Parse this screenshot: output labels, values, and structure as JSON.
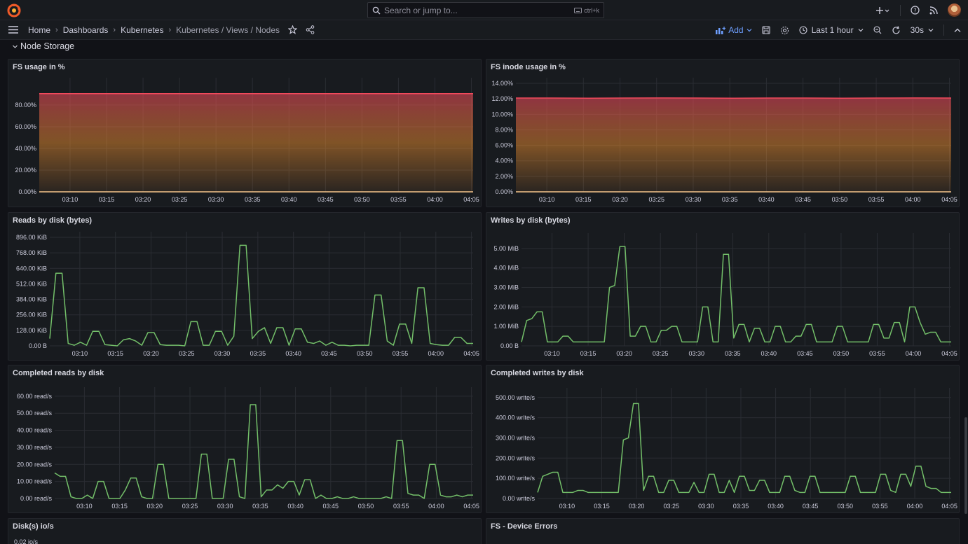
{
  "topbar": {
    "search_placeholder": "Search or jump to...",
    "search_shortcut": "ctrl+k",
    "icons": [
      "grafana-logo-icon",
      "search-icon",
      "keyboard-icon",
      "plus-icon",
      "help-icon",
      "rss-icon",
      "avatar"
    ]
  },
  "breadcrumbs": [
    "Home",
    "Dashboards",
    "Kubernetes",
    "Kubernetes / Views / Nodes"
  ],
  "toolbar": {
    "add_label": "Add",
    "time_range": "Last 1 hour",
    "refresh_interval": "30s"
  },
  "section": {
    "title": "Node Storage"
  },
  "colors": {
    "green": "#73bf69",
    "red": "#f2495c",
    "orange_fill": "#ff9830",
    "threshold": "#f5c48a"
  },
  "panels": [
    {
      "title": "FS usage in %",
      "chart_data": {
        "type": "area",
        "x_ticks": [
          "03:10",
          "03:15",
          "03:20",
          "03:25",
          "03:30",
          "03:35",
          "03:40",
          "03:45",
          "03:50",
          "03:55",
          "04:00",
          "04:05"
        ],
        "y_ticks": [
          "80.00%",
          "60.00%",
          "40.00%",
          "20.00%",
          "0.00%"
        ],
        "ylim": [
          0,
          100
        ],
        "series": [
          {
            "values": [
              90.5,
              90.5,
              90.5,
              90.5,
              90.5,
              90.5,
              90.5,
              90.5,
              90.5,
              90.5,
              90.5,
              90.5,
              90.5
            ]
          },
          {
            "values": [
              0,
              0,
              0,
              0,
              0,
              0,
              0,
              0,
              0,
              0,
              0,
              0,
              0
            ]
          }
        ]
      }
    },
    {
      "title": "FS inode usage in %",
      "chart_data": {
        "type": "area",
        "x_ticks": [
          "03:10",
          "03:15",
          "03:20",
          "03:25",
          "03:30",
          "03:35",
          "03:40",
          "03:45",
          "03:50",
          "03:55",
          "04:00",
          "04:05"
        ],
        "y_ticks": [
          "14.00%",
          "12.00%",
          "10.00%",
          "8.00%",
          "6.00%",
          "4.00%",
          "2.00%",
          "0.00%"
        ],
        "ylim": [
          0,
          14
        ],
        "series": [
          {
            "values": [
              12.1,
              12.1,
              12.08,
              12.1,
              12.12,
              12.1,
              12.08,
              12.1,
              12.1,
              12.08,
              12.1,
              12.12,
              12.1
            ]
          },
          {
            "values": [
              0,
              0,
              0,
              0,
              0,
              0,
              0,
              0,
              0,
              0,
              0,
              0,
              0
            ]
          }
        ]
      }
    },
    {
      "title": "Reads by disk (bytes)",
      "chart_data": {
        "type": "line",
        "x_ticks": [
          "03:10",
          "03:15",
          "03:20",
          "03:25",
          "03:30",
          "03:35",
          "03:40",
          "03:45",
          "03:50",
          "03:55",
          "04:00",
          "04:05"
        ],
        "y_ticks": [
          "896.00 KiB",
          "768.00 KiB",
          "640.00 KiB",
          "512.00 KiB",
          "384.00 KiB",
          "256.00 KiB",
          "128.00 KiB",
          "0.00 B"
        ],
        "ylim": [
          0,
          896
        ],
        "series": [
          {
            "values": [
              60,
              600,
              600,
              20,
              5,
              30,
              5,
              120,
              120,
              10,
              5,
              0,
              50,
              60,
              40,
              5,
              110,
              110,
              10,
              5,
              5,
              5,
              0,
              200,
              200,
              5,
              5,
              120,
              120,
              5,
              80,
              830,
              830,
              60,
              120,
              150,
              20,
              150,
              150,
              5,
              140,
              140,
              30,
              20,
              40,
              5,
              30,
              5,
              5,
              0,
              5,
              5,
              5,
              420,
              420,
              40,
              5,
              180,
              180,
              20,
              480,
              480,
              20,
              10,
              5,
              5,
              70,
              70,
              20,
              20
            ]
          }
        ]
      }
    },
    {
      "title": "Writes by disk (bytes)",
      "chart_data": {
        "type": "line",
        "x_ticks": [
          "03:10",
          "03:15",
          "03:20",
          "03:25",
          "03:30",
          "03:35",
          "03:40",
          "03:45",
          "03:50",
          "03:55",
          "04:00",
          "04:05"
        ],
        "y_ticks": [
          "5.00 MiB",
          "4.00 MiB",
          "3.00 MiB",
          "2.00 MiB",
          "1.00 MiB",
          "0.00 B"
        ],
        "ylim": [
          0,
          5.5
        ],
        "series": [
          {
            "values": [
              0.2,
              1.3,
              1.4,
              1.75,
              1.75,
              0.2,
              0.2,
              0.2,
              0.5,
              0.5,
              0.2,
              0.2,
              0.2,
              0.2,
              0.2,
              0.2,
              0.2,
              3,
              3.1,
              5.1,
              5.1,
              0.5,
              0.5,
              1,
              1,
              0.2,
              0.2,
              0.8,
              0.8,
              1,
              1,
              0.2,
              0.2,
              0.2,
              0.2,
              2,
              2,
              0.2,
              0.2,
              4.7,
              4.7,
              0.4,
              1.1,
              1.1,
              0.2,
              0.9,
              0.9,
              0.2,
              0.2,
              1,
              1,
              0.2,
              0.2,
              0.5,
              0.5,
              1.1,
              1.1,
              0.2,
              0.2,
              0.2,
              0.2,
              1,
              1,
              0.2,
              0.2,
              0.2,
              0.2,
              0.2,
              1.1,
              1.1,
              0.4,
              0.4,
              1.2,
              1.2,
              0.2,
              2,
              2,
              1.2,
              0.6,
              0.7,
              0.7,
              0.2,
              0.2,
              0.2
            ]
          }
        ]
      }
    },
    {
      "title": "Completed reads by disk",
      "chart_data": {
        "type": "line",
        "x_ticks": [
          "03:10",
          "03:15",
          "03:20",
          "03:25",
          "03:30",
          "03:35",
          "03:40",
          "03:45",
          "03:50",
          "03:55",
          "04:00",
          "04:05"
        ],
        "y_ticks": [
          "60.00 read/s",
          "50.00 read/s",
          "40.00 read/s",
          "30.00 read/s",
          "20.00 read/s",
          "10.00 read/s",
          "0.00 read/s"
        ],
        "ylim": [
          0,
          62
        ],
        "series": [
          {
            "values": [
              15,
              13,
              13,
              1,
              0,
              0,
              2,
              0,
              10,
              10,
              0,
              0,
              0,
              5,
              12,
              12,
              1,
              0,
              0,
              20,
              20,
              0,
              0,
              0,
              0,
              0,
              0,
              26,
              26,
              0,
              0,
              0,
              23,
              23,
              1,
              0,
              55,
              55,
              1,
              5,
              5,
              8,
              6,
              10,
              10,
              2,
              11,
              11,
              0,
              2,
              0,
              0,
              1,
              0,
              0,
              1,
              0,
              0,
              0,
              0,
              0,
              1,
              0,
              34,
              34,
              3,
              2,
              2,
              0,
              20,
              20,
              2,
              1,
              1,
              2,
              1,
              2,
              2
            ]
          }
        ]
      }
    },
    {
      "title": "Completed writes by disk",
      "chart_data": {
        "type": "line",
        "x_ticks": [
          "03:10",
          "03:15",
          "03:20",
          "03:25",
          "03:30",
          "03:35",
          "03:40",
          "03:45",
          "03:50",
          "03:55",
          "04:00",
          "04:05"
        ],
        "y_ticks": [
          "500.00 write/s",
          "400.00 write/s",
          "300.00 write/s",
          "200.00 write/s",
          "100.00 write/s",
          "0.00 write/s"
        ],
        "ylim": [
          0,
          520
        ],
        "series": [
          {
            "values": [
              30,
              110,
              120,
              130,
              130,
              30,
              30,
              30,
              40,
              40,
              30,
              30,
              30,
              30,
              30,
              30,
              30,
              290,
              300,
              470,
              470,
              40,
              110,
              110,
              30,
              30,
              90,
              90,
              30,
              30,
              30,
              80,
              30,
              30,
              120,
              120,
              30,
              30,
              90,
              30,
              110,
              110,
              40,
              40,
              90,
              90,
              30,
              30,
              30,
              110,
              110,
              40,
              30,
              30,
              110,
              110,
              30,
              30,
              30,
              30,
              30,
              30,
              110,
              110,
              30,
              30,
              30,
              30,
              120,
              120,
              40,
              30,
              120,
              120,
              60,
              160,
              160,
              60,
              50,
              50,
              30,
              30,
              30
            ]
          }
        ]
      }
    },
    {
      "title": "Disk(s) io/s",
      "chart_data": {
        "type": "line",
        "y_ticks": [
          "0.02 io/s"
        ]
      }
    },
    {
      "title": "FS - Device Errors"
    }
  ]
}
